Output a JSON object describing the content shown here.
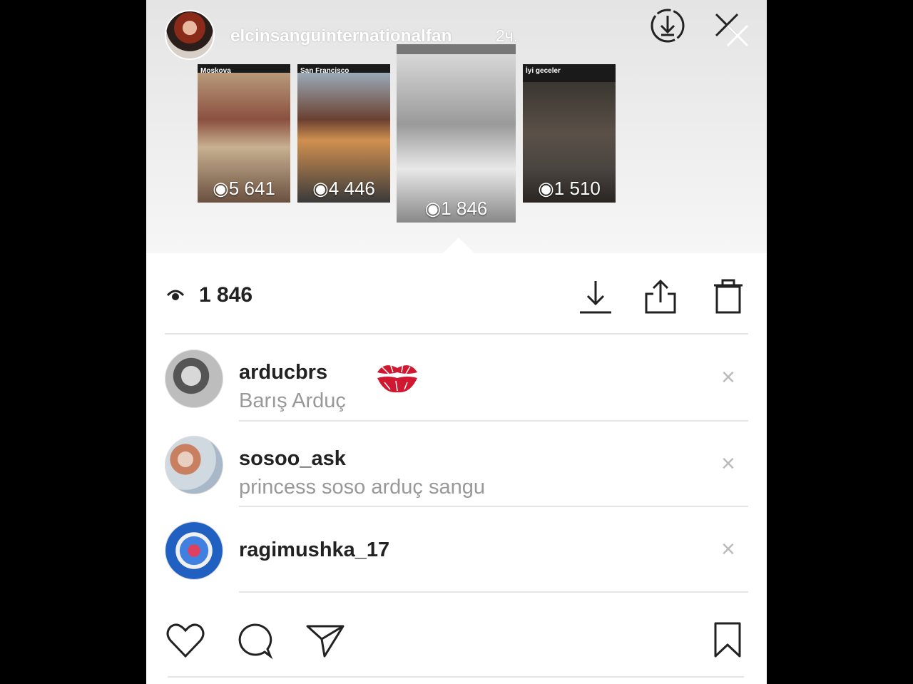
{
  "header": {
    "username": "elcinsanguinternationalfan",
    "time": "2ч."
  },
  "stories": [
    {
      "caption": "Moskova",
      "views": "5 641"
    },
    {
      "caption": "San Francisco",
      "views": "4 446"
    },
    {
      "caption": "",
      "views": "1 846"
    },
    {
      "caption": "İyi geceler",
      "views": "1 510"
    }
  ],
  "stats": {
    "view_count": "1 846"
  },
  "viewers": [
    {
      "username": "arducbrs",
      "full_name": "Barış Arduç"
    },
    {
      "username": "sosoo_ask",
      "full_name": "princess soso arduç sangu"
    },
    {
      "username": "ragimushka_17",
      "full_name": ""
    }
  ],
  "colors": {
    "text_primary": "#222222",
    "text_secondary": "#999999",
    "divider": "#e4e4e4"
  }
}
